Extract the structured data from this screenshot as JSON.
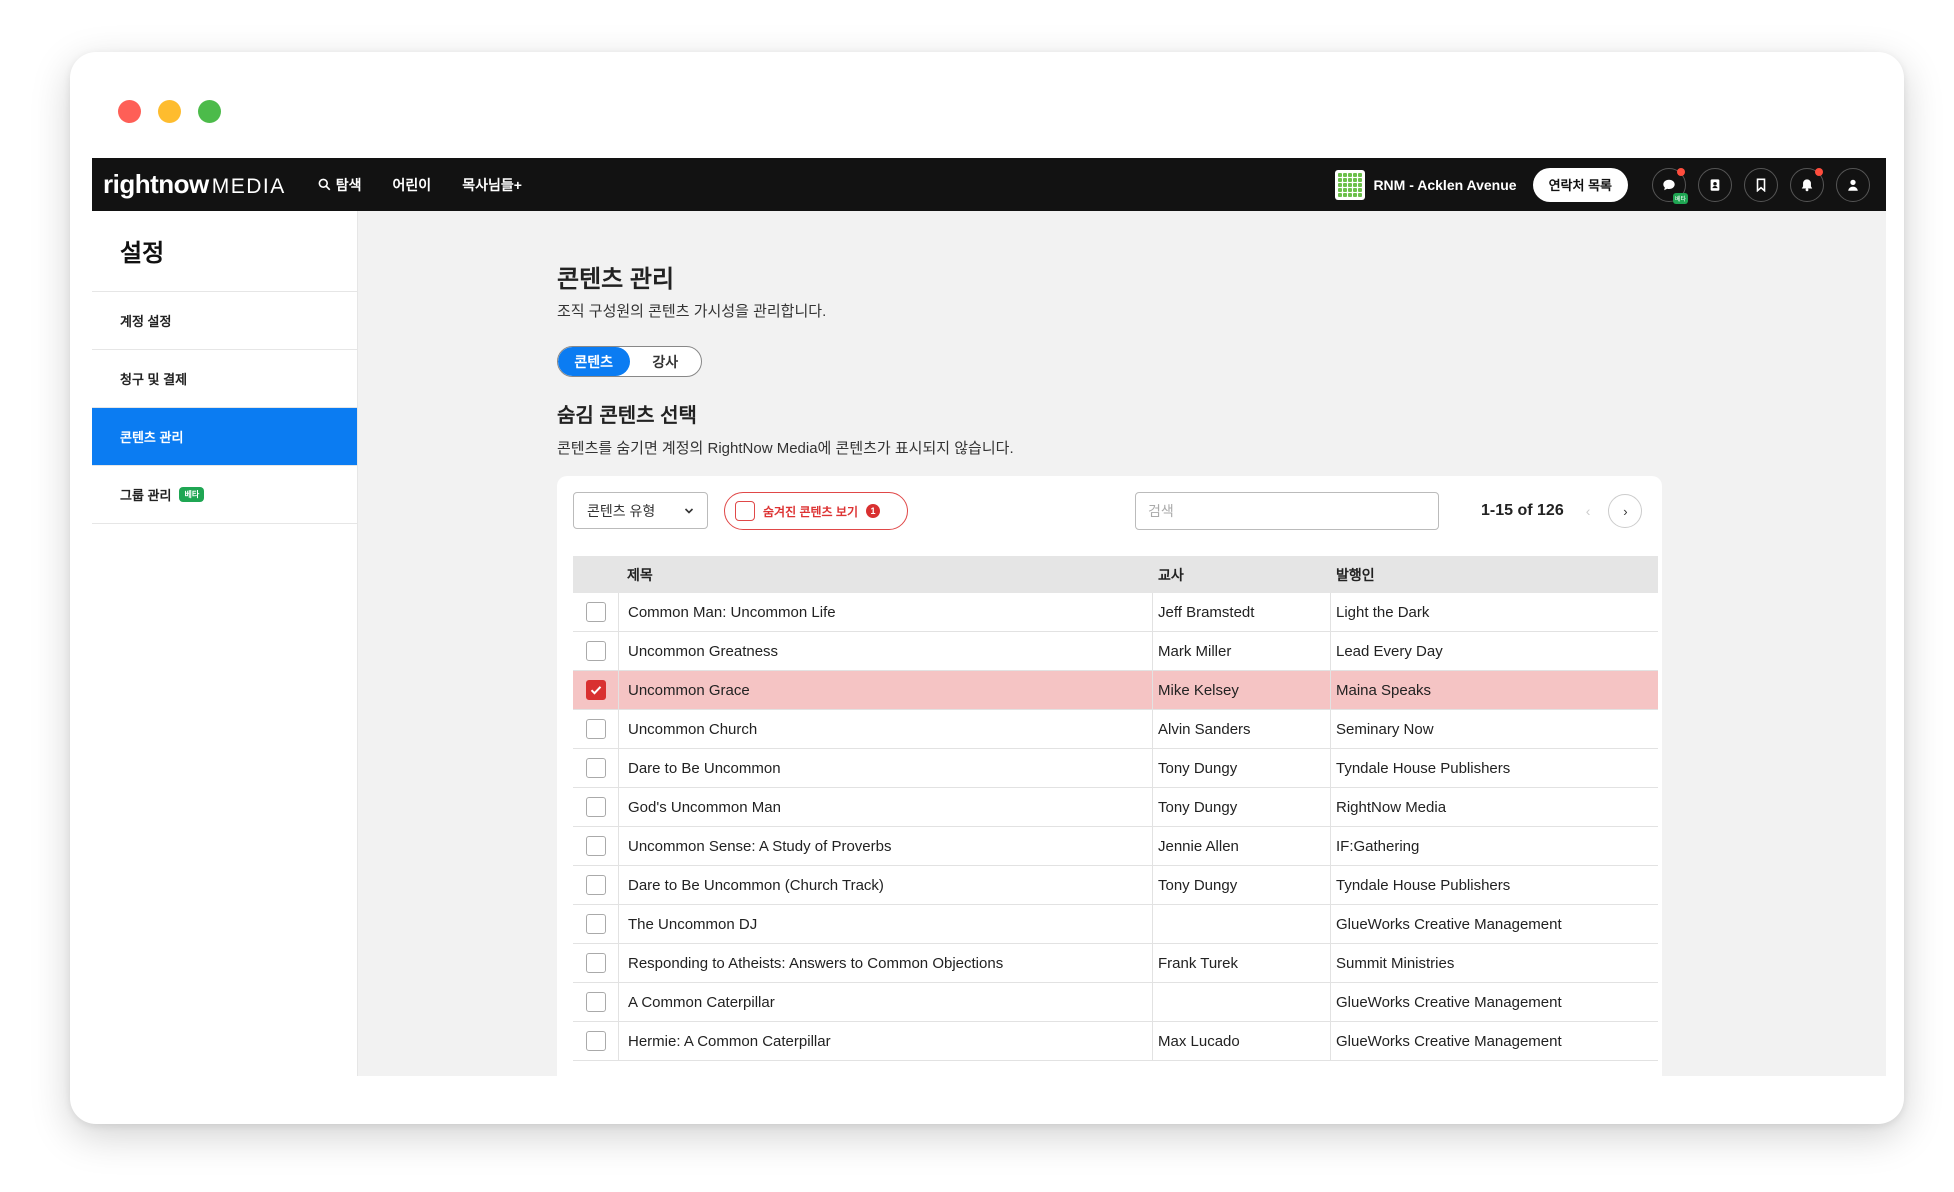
{
  "window": {
    "title": ""
  },
  "nav": {
    "logo_bold": "rightnow",
    "logo_thin": "MEDIA",
    "items": [
      {
        "label": "탐색",
        "icon": "search-icon"
      },
      {
        "label": "어린이"
      },
      {
        "label": "목사님들+"
      }
    ],
    "org_name": "RNM - Acklen Avenue",
    "contacts_button": "연락처 목록",
    "mini_badge": "베타"
  },
  "sidebar": {
    "title": "설정",
    "items": [
      {
        "label": "계정 설정"
      },
      {
        "label": "청구 및 결제"
      },
      {
        "label": "콘텐츠 관리",
        "active": true
      },
      {
        "label": "그룹 관리",
        "badge": "베타"
      }
    ]
  },
  "main": {
    "title": "콘텐츠 관리",
    "subtitle": "조직 구성원의 콘텐츠 가시성을 관리합니다.",
    "tabs": [
      {
        "label": "콘텐츠",
        "active": true
      },
      {
        "label": "강사"
      }
    ],
    "section_title": "숨김 콘텐츠 선택",
    "section_sub": "콘텐츠를 숨기면 계정의 RightNow Media에 콘텐츠가 표시되지 않습니다.",
    "filter_select": "콘텐츠 유형",
    "hidden_toggle_label": "숨겨진 콘텐츠 보기",
    "hidden_count": "1",
    "search_placeholder": "검색",
    "pager_text": "1-15 of 126",
    "pager_prev": "‹",
    "pager_next": "›"
  },
  "table": {
    "headers": {
      "title": "제목",
      "teacher": "교사",
      "publisher": "발행인"
    },
    "rows": [
      {
        "title": "Common Man: Uncommon Life",
        "teacher": "Jeff Bramstedt",
        "publisher": "Light the Dark",
        "checked": false
      },
      {
        "title": "Uncommon Greatness",
        "teacher": "Mark Miller",
        "publisher": "Lead Every Day",
        "checked": false
      },
      {
        "title": "Uncommon Grace",
        "teacher": "Mike Kelsey",
        "publisher": "Maina Speaks",
        "checked": true
      },
      {
        "title": "Uncommon Church",
        "teacher": "Alvin Sanders",
        "publisher": "Seminary Now",
        "checked": false
      },
      {
        "title": "Dare to Be Uncommon",
        "teacher": "Tony Dungy",
        "publisher": "Tyndale House Publishers",
        "checked": false
      },
      {
        "title": "God's Uncommon Man",
        "teacher": "Tony Dungy",
        "publisher": "RightNow Media",
        "checked": false
      },
      {
        "title": "Uncommon Sense: A Study of Proverbs",
        "teacher": "Jennie Allen",
        "publisher": "IF:Gathering",
        "checked": false
      },
      {
        "title": "Dare to Be Uncommon (Church Track)",
        "teacher": "Tony Dungy",
        "publisher": "Tyndale House Publishers",
        "checked": false
      },
      {
        "title": "The Uncommon DJ",
        "teacher": "",
        "publisher": "GlueWorks Creative Management",
        "checked": false
      },
      {
        "title": "Responding to Atheists: Answers to Common Objections",
        "teacher": "Frank Turek",
        "publisher": "Summit Ministries",
        "checked": false
      },
      {
        "title": "A Common Caterpillar",
        "teacher": "",
        "publisher": "GlueWorks Creative Management",
        "checked": false
      },
      {
        "title": "Hermie: A Common Caterpillar",
        "teacher": "Max Lucado",
        "publisher": "GlueWorks Creative Management",
        "checked": false
      }
    ]
  },
  "colors": {
    "nav_bg": "#121212",
    "accent_blue": "#0b7cf2",
    "danger_red": "#d93030",
    "selected_row": "#f5c4c4",
    "beta_green": "#1fa653"
  }
}
